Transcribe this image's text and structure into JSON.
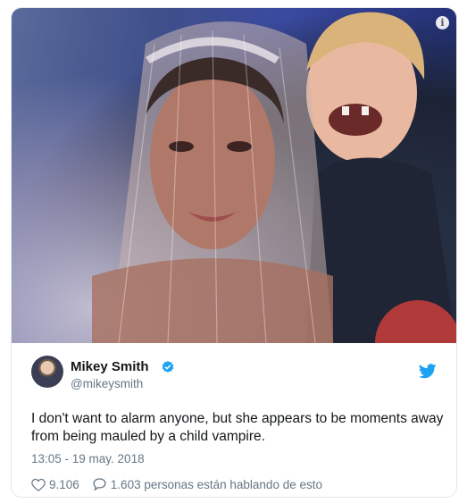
{
  "tweet": {
    "author_name": "Mikey Smith",
    "author_handle": "@mikeysmith",
    "text": "I don't want to alarm anyone, but she appears to be moments away from being mauled by a child vampire.",
    "timestamp": "13:05 - 19 may. 2018",
    "likes": "9.106",
    "talking": "1.603 personas están hablando de esto",
    "verified": true
  },
  "colors": {
    "twitter_blue": "#1da1f2",
    "text_primary": "#14171a",
    "text_secondary": "#657786",
    "border": "#e1e8ed"
  },
  "icons": {
    "info": "info-icon",
    "verified": "verified-badge-icon",
    "bird": "twitter-bird-icon",
    "like": "heart-icon",
    "reply": "speech-bubble-icon"
  }
}
